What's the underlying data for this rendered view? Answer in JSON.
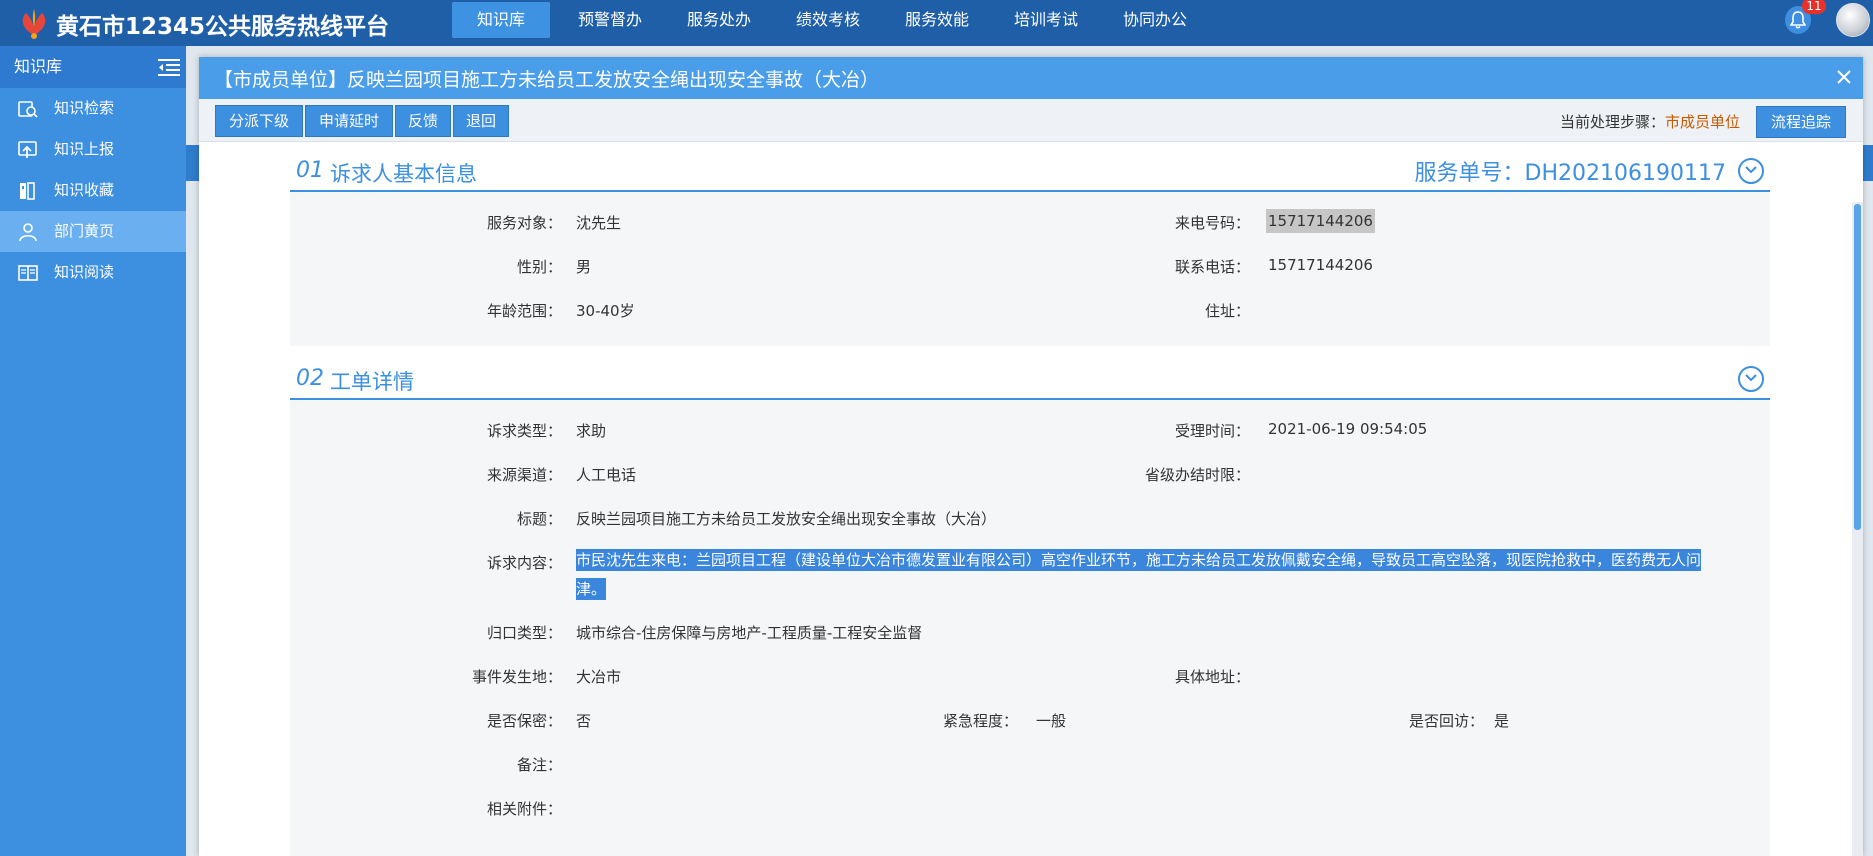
{
  "app": {
    "title": "黄石市12345公共服务热线平台",
    "notifications": "11"
  },
  "nav": [
    {
      "label": "知识库",
      "active": true
    },
    {
      "label": "预警督办",
      "active": false
    },
    {
      "label": "服务处办",
      "active": false
    },
    {
      "label": "绩效考核",
      "active": false
    },
    {
      "label": "服务效能",
      "active": false
    },
    {
      "label": "培训考试",
      "active": false
    },
    {
      "label": "协同办公",
      "active": false
    }
  ],
  "sidebar": {
    "title": "知识库",
    "items": [
      {
        "label": "知识检索",
        "icon": "search-book-icon",
        "active": false
      },
      {
        "label": "知识上报",
        "icon": "upload-icon",
        "active": false
      },
      {
        "label": "知识收藏",
        "icon": "bookmark-icon",
        "active": false
      },
      {
        "label": "部门黄页",
        "icon": "user-icon",
        "active": true
      },
      {
        "label": "知识阅读",
        "icon": "open-book-icon",
        "active": false
      }
    ]
  },
  "modal": {
    "title": "【市成员单位】反映兰园项目施工方未给员工发放安全绳出现安全事故（大冶）",
    "toolbar": {
      "dispatch": "分派下级",
      "extend": "申请延时",
      "feedback": "反馈",
      "return": "退回"
    },
    "step_label": "当前处理步骤：",
    "step_value": "市成员单位",
    "trace": "流程追踪"
  },
  "section1": {
    "num": "01",
    "title": "诉求人基本信息",
    "service_no": "服务单号：DH202106190117",
    "fields": {
      "target_label": "服务对象：",
      "target": "沈先生",
      "caller_label": "来电号码：",
      "caller": "15717144206",
      "gender_label": "性别：",
      "gender": "男",
      "contact_label": "联系电话：",
      "contact": "15717144206",
      "age_label": "年龄范围：",
      "age": "30-40岁",
      "address_label": "住址：",
      "address": ""
    }
  },
  "section2": {
    "num": "02",
    "title": "工单详情",
    "fields": {
      "type_label": "诉求类型：",
      "type": "求助",
      "time_label": "受理时间：",
      "time": "2021-06-19 09:54:05",
      "source_label": "来源渠道：",
      "source": "人工电话",
      "deadline_label": "省级办结时限：",
      "deadline": "",
      "subject_label": "标题：",
      "subject": "反映兰园项目施工方未给员工发放安全绳出现安全事故（大冶）",
      "content_label": "诉求内容：",
      "content_line1": "市民沈先生来电：兰园项目工程（建设单位大冶市德发置业有限公司）高空作业环节，施工方未给员工发放佩戴安全绳，导致员工高空坠落，现医院抢救中，医药费无人问",
      "content_line2": "津。",
      "category_label": "归口类型：",
      "category": "城市综合-住房保障与房地产-工程质量-工程安全监督",
      "place_label": "事件发生地：",
      "place": "大冶市",
      "detail_addr_label": "具体地址：",
      "detail_addr": "",
      "secret_label": "是否保密：",
      "secret": "否",
      "urgency_label": "紧急程度：",
      "urgency": "一般",
      "revisit_label": "是否回访：",
      "revisit": "是",
      "remark_label": "备注：",
      "remark": "",
      "attach_label": "相关附件：",
      "attach": ""
    }
  }
}
